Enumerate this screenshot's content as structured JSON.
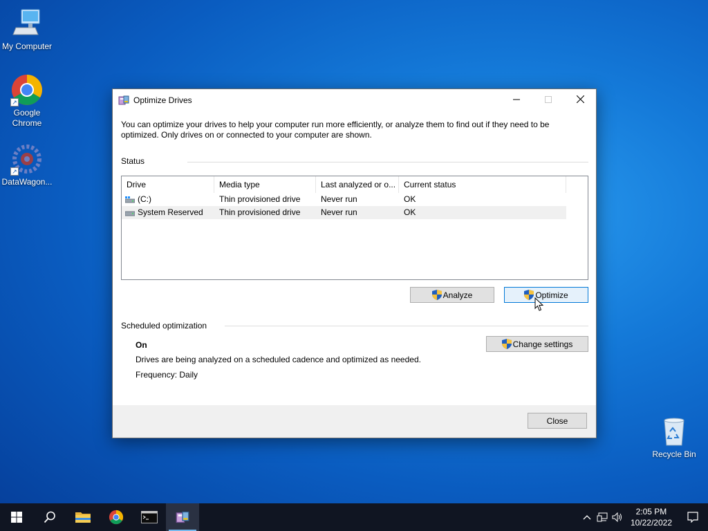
{
  "desktop": {
    "icons": [
      {
        "label": "My Computer",
        "icon": "computer-icon"
      },
      {
        "label": "Google Chrome",
        "icon": "chrome-icon"
      },
      {
        "label": "DataWagon...",
        "icon": "datawagon-icon"
      },
      {
        "label": "Recycle Bin",
        "icon": "recycle-bin-icon"
      }
    ]
  },
  "window": {
    "title": "Optimize Drives",
    "intro": "You can optimize your drives to help your computer run more efficiently, or analyze them to find out if they need to be optimized. Only drives on or connected to your computer are shown.",
    "status_label": "Status",
    "columns": [
      "Drive",
      "Media type",
      "Last analyzed or o...",
      "Current status"
    ],
    "drives": [
      {
        "drive": "(C:)",
        "media": "Thin provisioned drive",
        "last": "Never run",
        "status": "OK"
      },
      {
        "drive": "System Reserved",
        "media": "Thin provisioned drive",
        "last": "Never run",
        "status": "OK"
      }
    ],
    "analyze_label": "Analyze",
    "optimize_label": "Optimize",
    "scheduled_label": "Scheduled optimization",
    "sched_state": "On",
    "sched_desc": "Drives are being analyzed on a scheduled cadence and optimized as needed.",
    "sched_freq": "Frequency: Daily",
    "change_settings_label": "Change settings",
    "close_label": "Close"
  },
  "taskbar": {
    "time": "2:05 PM",
    "date": "10/22/2022"
  },
  "colors": {
    "accent": "#0078d7",
    "taskbar": "#101522"
  }
}
